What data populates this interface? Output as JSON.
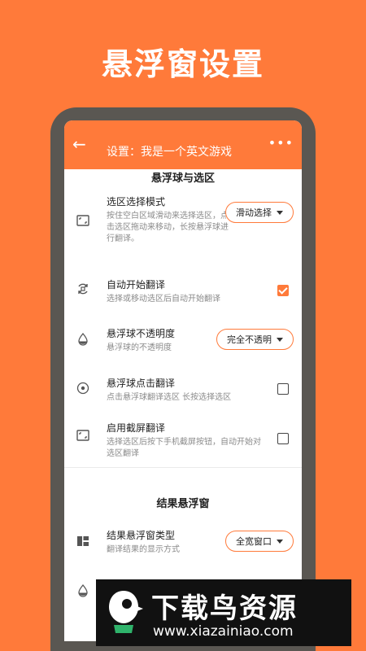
{
  "headline": "悬浮窗设置",
  "appbar": {
    "title": "设置：我是一个英文游戏"
  },
  "sections": [
    {
      "header": "悬浮球与选区"
    },
    {
      "header": "结果悬浮窗"
    }
  ],
  "rows": [
    {
      "label": "选区选择模式",
      "desc": "按住空白区域滑动来选择选区，点击选区拖动来移动，长按悬浮球进行翻译。",
      "control": "dropdown",
      "value": "滑动选择",
      "icon": "crop-icon"
    },
    {
      "label": "自动开始翻译",
      "desc": "选择或移动选区后自动开始翻译",
      "control": "checkbox",
      "checked": true,
      "icon": "auto-rotate-icon"
    },
    {
      "label": "悬浮球不透明度",
      "desc": "悬浮球的不透明度",
      "control": "dropdown",
      "value": "完全不透明",
      "icon": "opacity-drop-icon"
    },
    {
      "label": "悬浮球点击翻译",
      "desc": "点击悬浮球翻译选区 长按选择选区",
      "control": "checkbox",
      "checked": false,
      "icon": "target-icon"
    },
    {
      "label": "启用截屏翻译",
      "desc": "选择选区后按下手机截屏按钮，自动开始对选区翻译",
      "control": "checkbox",
      "checked": false,
      "icon": "screenshot-crop-icon"
    },
    {
      "label": "结果悬浮窗类型",
      "desc": "翻译结果的显示方式",
      "control": "dropdown",
      "value": "全宽窗口",
      "icon": "window-grid-icon"
    }
  ],
  "banner": {
    "name": "下载鸟资源",
    "url": "www.xiazainiao.com"
  },
  "colors": {
    "accent": "#FF7A3A",
    "phone_frame": "#5a5752"
  }
}
